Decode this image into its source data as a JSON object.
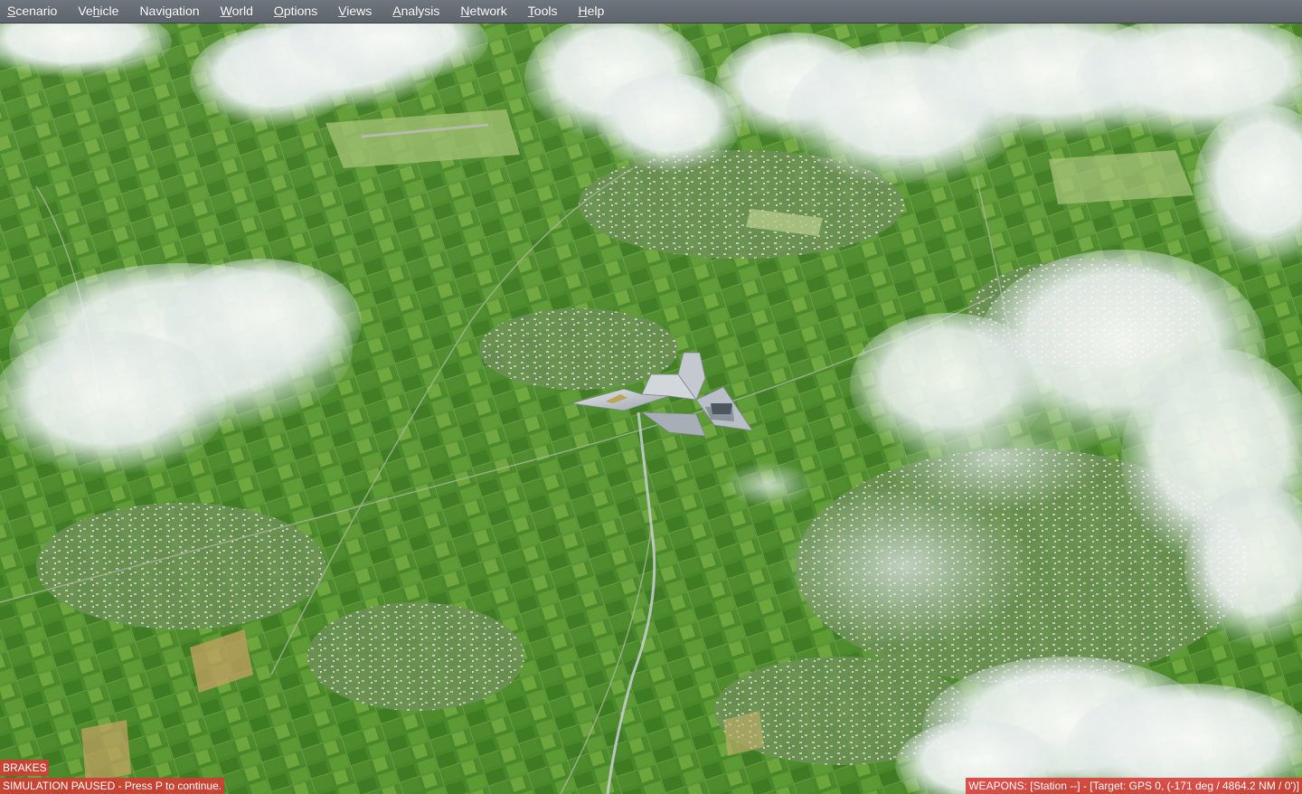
{
  "menubar": {
    "items": [
      {
        "accel": "S",
        "rest": "cenario"
      },
      {
        "pre": "Ve",
        "accel": "h",
        "rest": "icle"
      },
      {
        "accel": "",
        "rest": "Navigation"
      },
      {
        "accel": "W",
        "rest": "orld"
      },
      {
        "accel": "O",
        "rest": "ptions"
      },
      {
        "accel": "V",
        "rest": "iews"
      },
      {
        "accel": "A",
        "rest": "nalysis"
      },
      {
        "accel": "N",
        "rest": "etwork"
      },
      {
        "accel": "T",
        "rest": "ools"
      },
      {
        "accel": "H",
        "rest": "elp"
      }
    ]
  },
  "status": {
    "brakes": "BRAKES",
    "paused": "SIMULATION PAUSED - Press P to continue.",
    "weapons": "WEAPONS: [Station --] - [Target: GPS 0, (-171 deg / 4864.2 NM / 0')]"
  },
  "scene": {
    "aircraft": "fighter-jet",
    "colors": {
      "ground_base": "#4e8a2e",
      "ground_light": "#8fbf4a",
      "cloud": "#f4f7fa",
      "alert_bg": "#d63a34"
    }
  }
}
